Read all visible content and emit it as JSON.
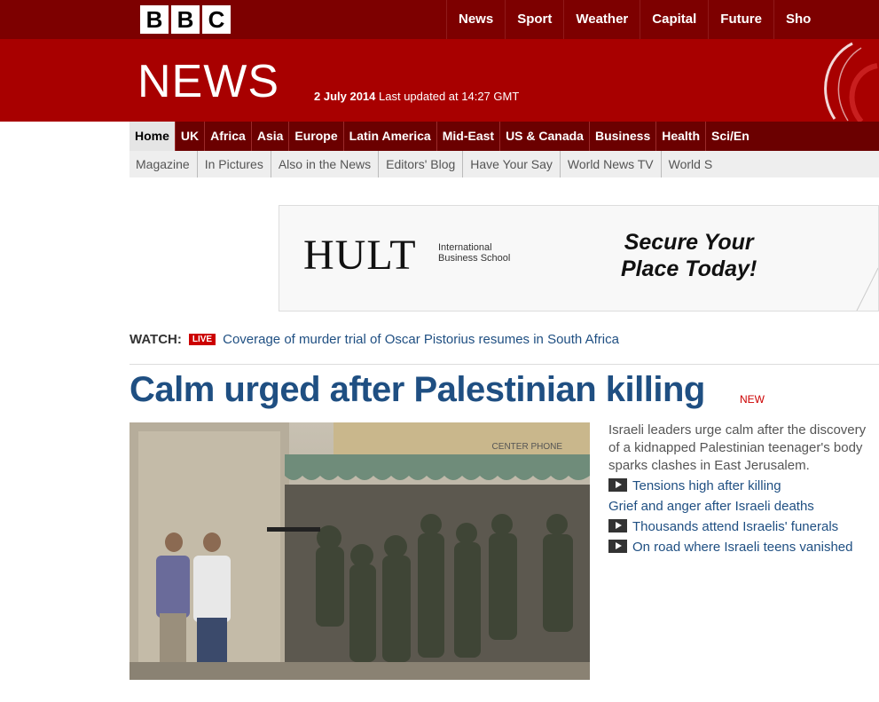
{
  "brand": {
    "letters": [
      "B",
      "B",
      "C"
    ]
  },
  "topnav": [
    "News",
    "Sport",
    "Weather",
    "Capital",
    "Future",
    "Sho"
  ],
  "masthead": {
    "title": "NEWS",
    "date": "2 July 2014",
    "updated": "Last updated at 14:27 GMT"
  },
  "primary_nav": [
    "Home",
    "UK",
    "Africa",
    "Asia",
    "Europe",
    "Latin America",
    "Mid-East",
    "US & Canada",
    "Business",
    "Health",
    "Sci/En"
  ],
  "secondary_nav": [
    "Magazine",
    "In Pictures",
    "Also in the News",
    "Editors' Blog",
    "Have Your Say",
    "World News TV",
    "World S"
  ],
  "ad": {
    "brand": "HULT",
    "brand_sub": "International Business School",
    "slogan_line1": "Secure Your",
    "slogan_line2": "Place Today!"
  },
  "watch": {
    "label": "WATCH:",
    "badge": "LIVE",
    "text": "Coverage of murder trial of Oscar Pistorius resumes in South Africa"
  },
  "story": {
    "headline": "Calm urged after Palestinian killing",
    "tag": "NEW",
    "summary": "Israeli leaders urge calm after the discovery of a kidnapped Palestinian teenager's body sparks clashes in East Jerusalem.",
    "related": [
      {
        "text": "Tensions high after killing",
        "video": true
      },
      {
        "text": "Grief and anger after Israeli deaths",
        "video": false
      },
      {
        "text": "Thousands attend Israelis' funerals",
        "video": true
      },
      {
        "text": "On road where Israeli teens vanished",
        "video": true
      }
    ],
    "photo_sign": "CENTER PHONE"
  },
  "colors": {
    "top": "#7d0000",
    "masthead": "#a80000",
    "nav": "#6b0000",
    "link": "#1f4f82",
    "live": "#cc0000"
  }
}
